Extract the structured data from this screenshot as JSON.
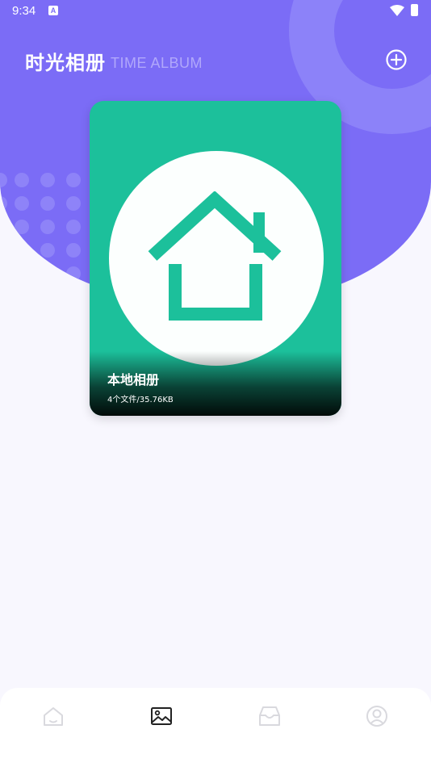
{
  "status_bar": {
    "time": "9:34",
    "notification_icon": "A"
  },
  "header": {
    "title": "时光相册",
    "subtitle": "TIME ALBUM",
    "add_icon": "plus-circle-icon"
  },
  "album": {
    "name": "本地相册",
    "meta": "4个文件/35.76KB",
    "cover_icon": "home-icon"
  },
  "bottom_nav": {
    "items": [
      {
        "icon": "home-icon",
        "active": false
      },
      {
        "icon": "image-icon",
        "active": true
      },
      {
        "icon": "inbox-icon",
        "active": false
      },
      {
        "icon": "user-icon",
        "active": false
      }
    ]
  },
  "colors": {
    "brand": "#7b6cf6",
    "album_cover": "#1cc09b",
    "nav_inactive": "#d9d9de",
    "nav_active": "#222222"
  }
}
